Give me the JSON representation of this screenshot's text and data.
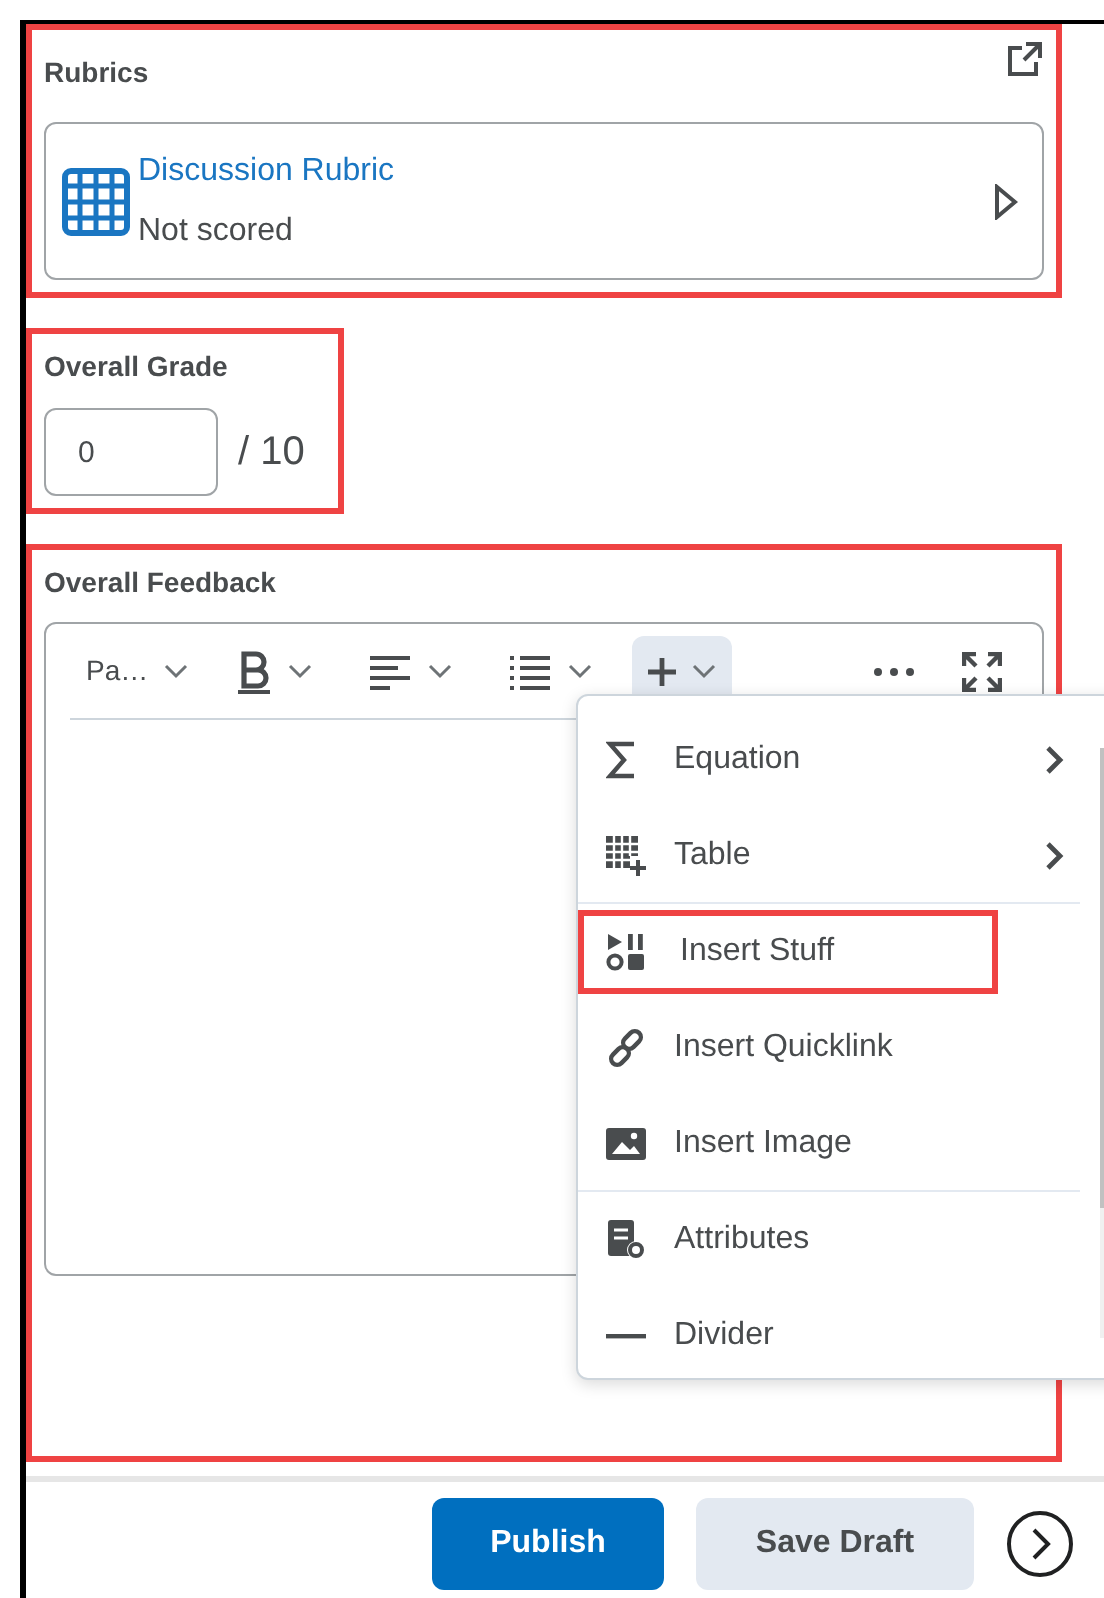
{
  "rubrics": {
    "title": "Rubrics",
    "card": {
      "name": "Discussion Rubric",
      "status": "Not scored"
    }
  },
  "grade": {
    "label": "Overall Grade",
    "value": "0",
    "out_of": "/ 10"
  },
  "feedback": {
    "label": "Overall Feedback",
    "toolbar": [
      {
        "kind": "format",
        "label": "Pa…",
        "active": false
      },
      {
        "kind": "bold",
        "active": false
      },
      {
        "kind": "align",
        "active": false
      },
      {
        "kind": "list",
        "active": false
      },
      {
        "kind": "insert",
        "active": true
      },
      {
        "kind": "more",
        "active": false
      },
      {
        "kind": "fullscreen",
        "active": false
      }
    ],
    "insert_menu": [
      {
        "kind": "equation",
        "label": "Equation",
        "submenu": true,
        "highlighted": false,
        "separator_after": false
      },
      {
        "kind": "table",
        "label": "Table",
        "submenu": true,
        "highlighted": false,
        "separator_after": true
      },
      {
        "kind": "stuff",
        "label": "Insert Stuff",
        "submenu": false,
        "highlighted": true,
        "separator_after": false
      },
      {
        "kind": "quicklink",
        "label": "Insert Quicklink",
        "submenu": false,
        "highlighted": false,
        "separator_after": false
      },
      {
        "kind": "image",
        "label": "Insert Image",
        "submenu": false,
        "highlighted": false,
        "separator_after": true
      },
      {
        "kind": "attributes",
        "label": "Attributes",
        "submenu": false,
        "highlighted": false,
        "separator_after": false
      },
      {
        "kind": "divider",
        "label": "Divider",
        "submenu": false,
        "highlighted": false,
        "separator_after": false
      }
    ]
  },
  "buttons": [
    {
      "kind": "primary",
      "label": "Publish"
    },
    {
      "kind": "secondary",
      "label": "Save Draft"
    }
  ]
}
